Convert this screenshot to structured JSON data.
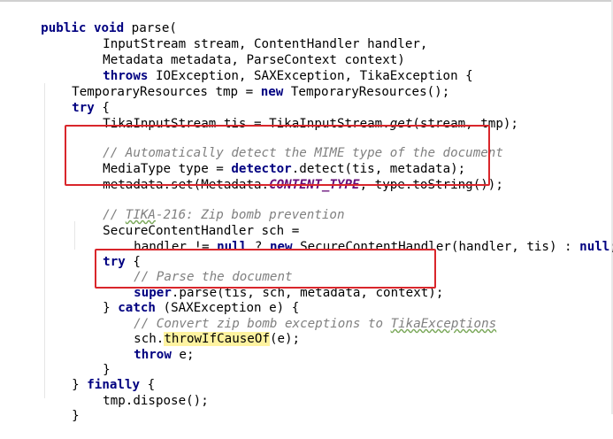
{
  "code": {
    "l1": {
      "a": "public",
      "b": " ",
      "c": "void",
      "d": " parse("
    },
    "l2": {
      "a": "InputStream stream, ContentHandler handler,"
    },
    "l3": {
      "a": "Metadata metadata, ParseContext context)"
    },
    "l4": {
      "a": "throws",
      "b": " IOException, SAXException, TikaException {"
    },
    "l5": {
      "a": "TemporaryResources tmp = ",
      "b": "new",
      "c": " TemporaryResources();"
    },
    "l6": {
      "a": "try",
      "b": " {"
    },
    "l7": {
      "a": "TikaInputStream tis = TikaInputStream.",
      "b": "get",
      "c": "(stream, tmp);"
    },
    "l9": {
      "a": "// Automatically detect the MIME type of the document"
    },
    "l10": {
      "a": "MediaType type = ",
      "b": "detector",
      "c": ".detect(tis, metadata);"
    },
    "l11": {
      "a": "metadata.set(Metadata.",
      "b": "CONTENT_TYPE",
      "c": ", type.toString());"
    },
    "l13": {
      "a": "// ",
      "b": "TIKA",
      "c": "-216: Zip bomb prevention"
    },
    "l14": {
      "a": "SecureContentHandler sch ="
    },
    "l15": {
      "a": "handler != ",
      "b": "null",
      "c": " ? ",
      "d": "new",
      "e": " SecureContentHandler(handler, tis) : ",
      "f": "null",
      "g": ";"
    },
    "l16": {
      "a": "try",
      "b": " {"
    },
    "l17": {
      "a": "// Parse the document"
    },
    "l18": {
      "a": "super",
      "b": ".parse(tis, sch, metadata, context);"
    },
    "l19": {
      "a": "} ",
      "b": "catch",
      "c": " (SAXException e) {"
    },
    "l20": {
      "a": "// Convert zip bomb exceptions to ",
      "b": "TikaExceptions"
    },
    "l21": {
      "a": "sch.",
      "b": "throwIfCauseOf",
      "c": "(e);"
    },
    "l22": {
      "a": "throw",
      "b": " e;"
    },
    "l23": {
      "a": "}"
    },
    "l24": {
      "a": "} ",
      "b": "finally",
      "c": " {"
    },
    "l25": {
      "a": "tmp.dispose();"
    },
    "l26": {
      "a": "}"
    },
    "l27": {
      "a": "}"
    }
  },
  "colors": {
    "keyword": "#000080",
    "comment": "#808080",
    "field": "#660e7a",
    "highlight": "#fff3a0",
    "box": "#d9262b"
  }
}
